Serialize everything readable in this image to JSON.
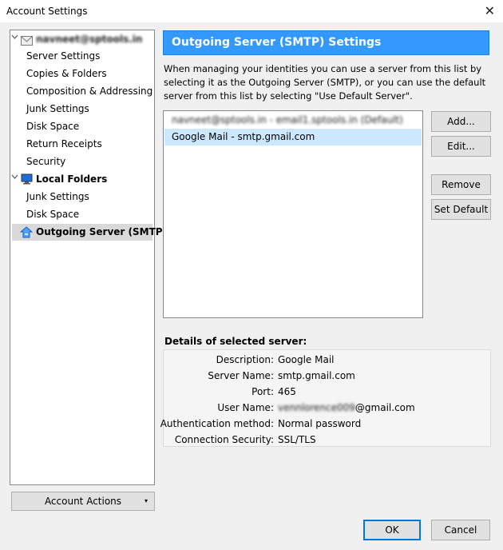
{
  "window": {
    "title": "Account Settings",
    "close_glyph": "✕"
  },
  "tree": {
    "account_email": "navneet@sptools.in",
    "account_items": [
      "Server Settings",
      "Copies & Folders",
      "Composition & Addressing",
      "Junk Settings",
      "Disk Space",
      "Return Receipts",
      "Security"
    ],
    "local_folders": "Local Folders",
    "local_items": [
      "Junk Settings",
      "Disk Space"
    ],
    "outgoing": "Outgoing Server (SMTP)"
  },
  "account_actions": {
    "label": "Account Actions",
    "caret": "▾"
  },
  "panel": {
    "header": "Outgoing Server (SMTP) Settings",
    "description": "When managing your identities you can use a server from this list by selecting it as the Outgoing Server (SMTP), or you can use the default server from this list by selecting \"Use Default Server\"."
  },
  "servers": [
    {
      "label": "navneet@sptools.in - email1.sptools.in (Default)",
      "blurred": true
    },
    {
      "label": "Google Mail - smtp.gmail.com",
      "blurred": false
    }
  ],
  "buttons": {
    "add": "Add...",
    "edit": "Edit...",
    "remove": "Remove",
    "set_default": "Set Default",
    "ok": "OK",
    "cancel": "Cancel"
  },
  "details": {
    "title": "Details of selected server:",
    "rows": [
      {
        "label": "Description:",
        "value": "Google Mail"
      },
      {
        "label": "Server Name:",
        "value": "smtp.gmail.com"
      },
      {
        "label": "Port:",
        "value": "465"
      },
      {
        "label": "User Name:",
        "value_blurred": "vennlorence009",
        "value": "@gmail.com"
      },
      {
        "label": "Authentication method:",
        "value": "Normal password"
      },
      {
        "label": "Connection Security:",
        "value": "SSL/TLS"
      }
    ]
  },
  "colors": {
    "header_bg": "#3399ff",
    "selection": "#cce8ff",
    "tree_selection": "#d9d9d9"
  }
}
